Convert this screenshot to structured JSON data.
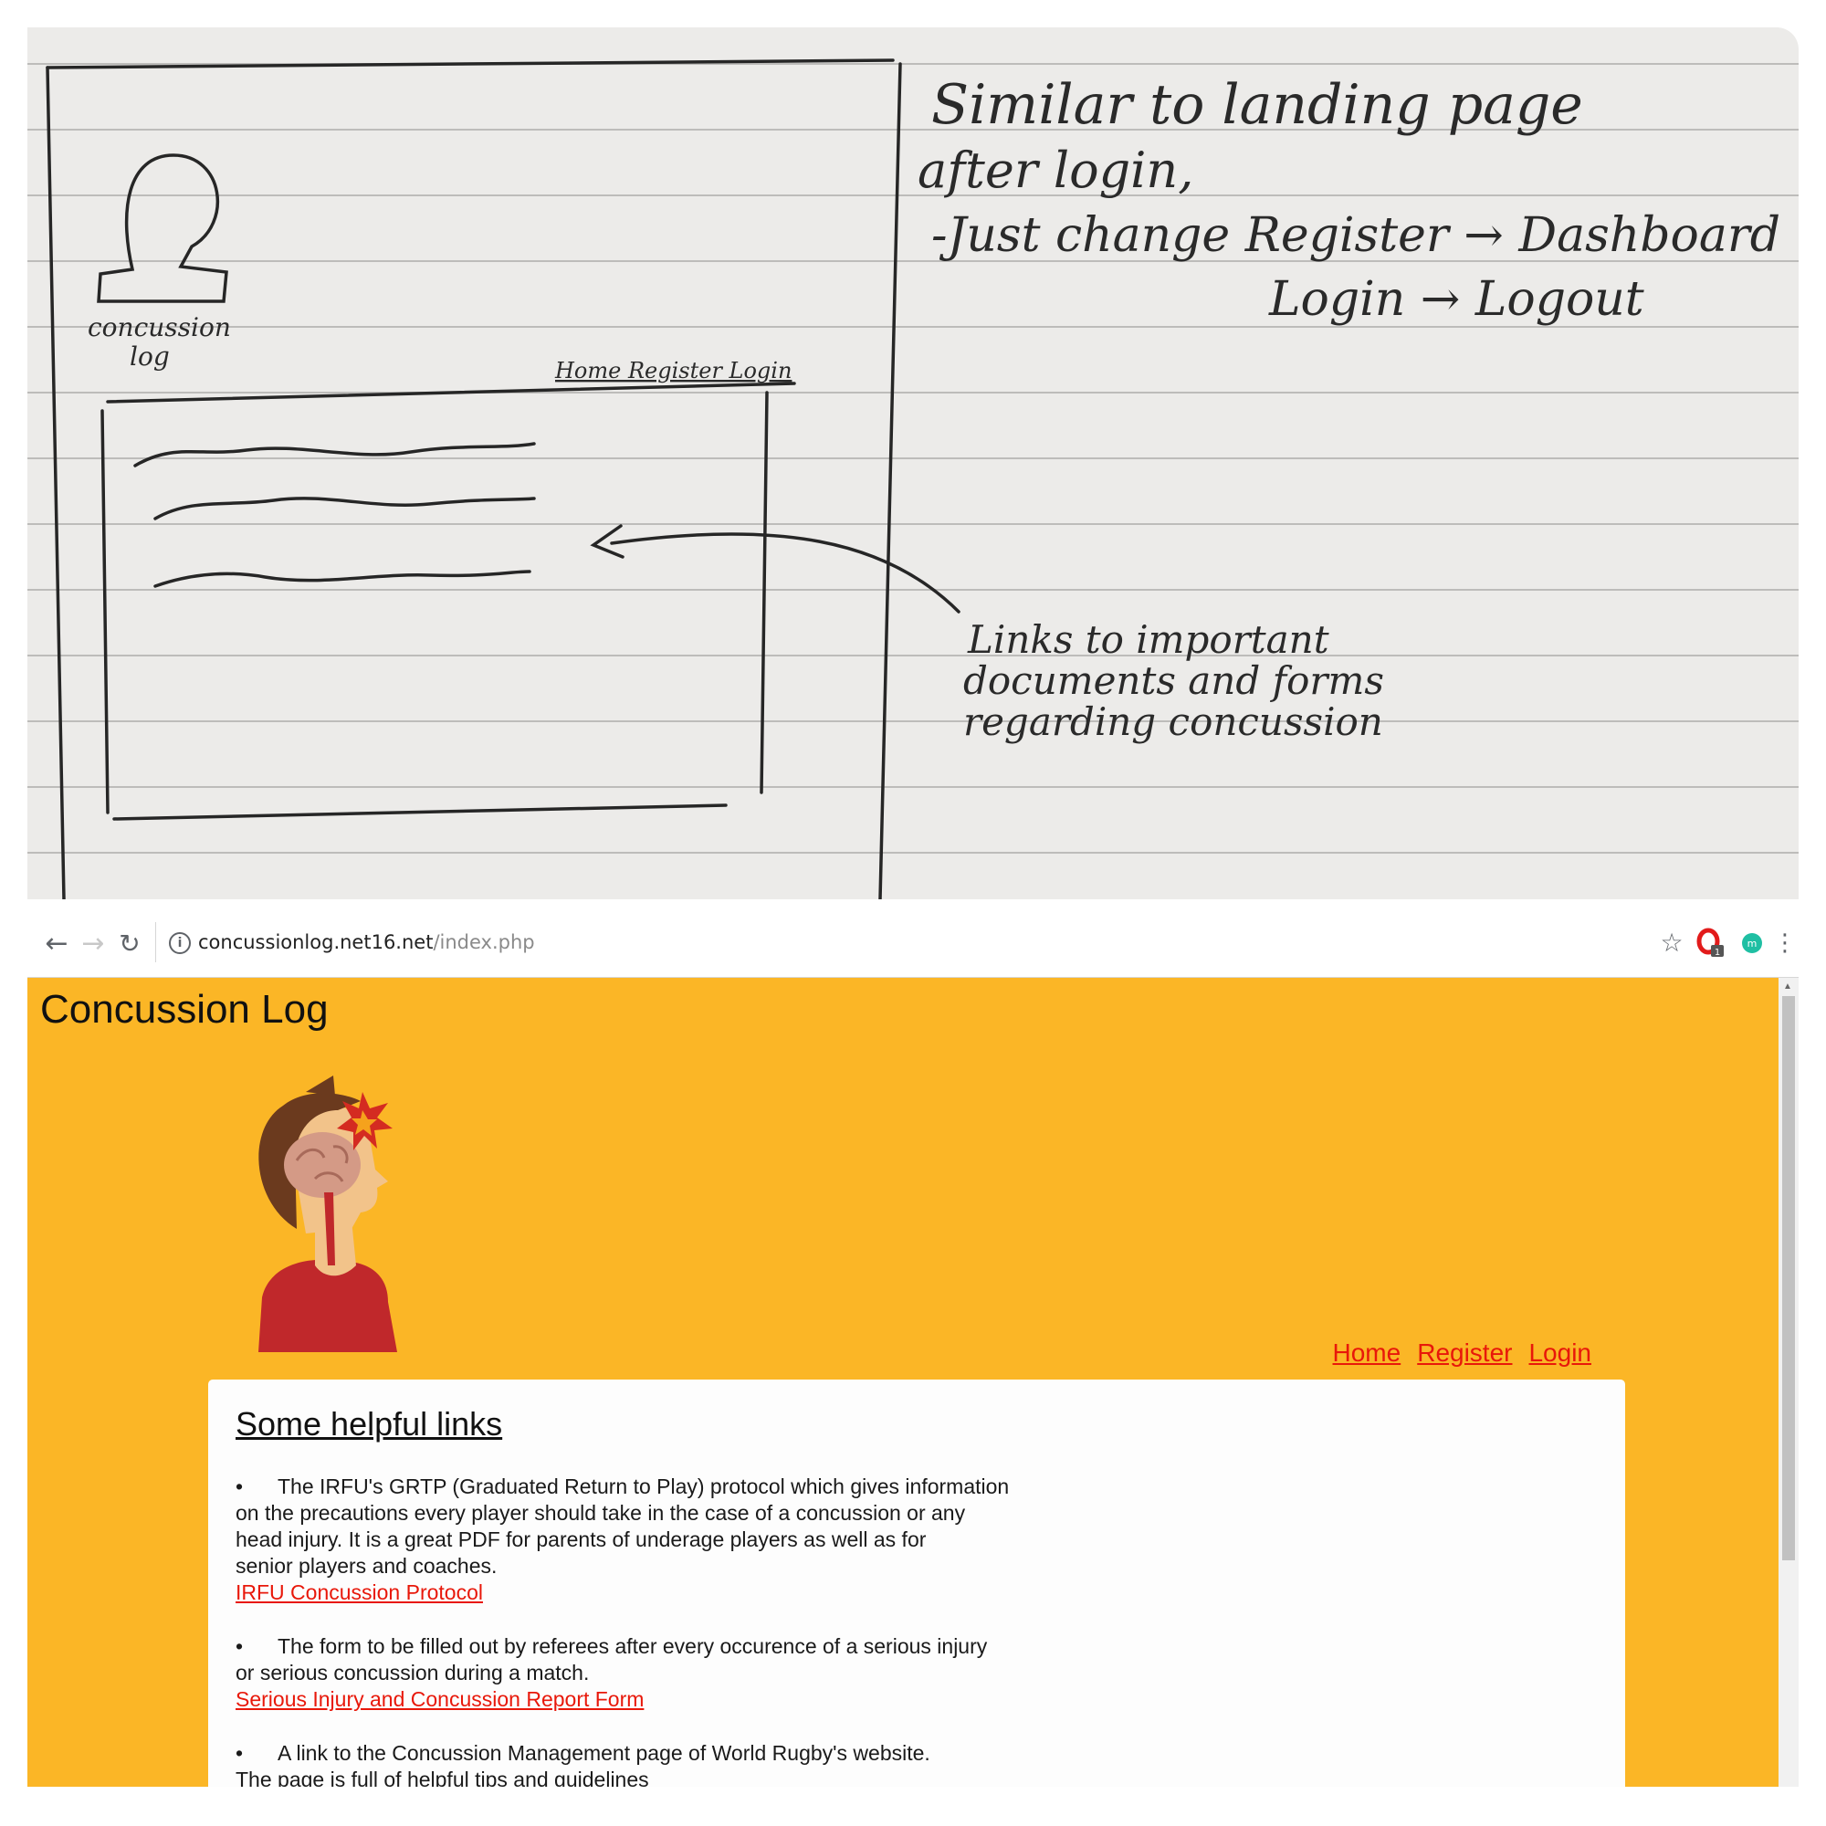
{
  "sketch": {
    "logo_caption_1": "concussion",
    "logo_caption_2": "log",
    "nav_labels": "Home Register Login",
    "note_lines": [
      "Similar to landing page",
      "after login,",
      "-Just change Register → Dashboard",
      "Login → Logout"
    ],
    "annotation_lines": [
      "Links to important",
      "documents and forms",
      "regarding concussion"
    ]
  },
  "browser": {
    "url_host": "concussionlog.net16.net",
    "url_path": "/index.php",
    "icons": {
      "back": "back-arrow-icon",
      "forward": "forward-arrow-icon",
      "reload": "reload-icon",
      "info": "info-icon",
      "bookmark": "star-icon",
      "extension_1": "opera-extension-icon",
      "extension_1_badge": "1",
      "extension_2": "profile-extension-icon",
      "menu": "kebab-menu-icon"
    }
  },
  "site": {
    "title": "Concussion Log",
    "nav": [
      "Home",
      "Register",
      "Login"
    ],
    "colors": {
      "background": "#fbb626",
      "link": "#e8180a",
      "panel": "#fdfdfd"
    },
    "links_heading": "Some helpful links",
    "items": [
      {
        "bullet": "•",
        "lines": [
          "The IRFU's GRTP (Graduated Return to Play) protocol which gives information",
          "on the precautions every player should take in the case of a concussion or any",
          "head injury. It is a great PDF for parents of underage players as well as for",
          "senior players and coaches."
        ],
        "link": "IRFU Concussion Protocol"
      },
      {
        "bullet": "•",
        "lines": [
          "The form to be filled out by referees after every occurence of a serious injury",
          "or serious concussion during a match."
        ],
        "link": "Serious Injury and Concussion Report Form"
      },
      {
        "bullet": "•",
        "lines": [
          "A link to the Concussion Management page of World Rugby's website.",
          "The page is full of helpful tips and guidelines"
        ],
        "link": ""
      }
    ]
  }
}
